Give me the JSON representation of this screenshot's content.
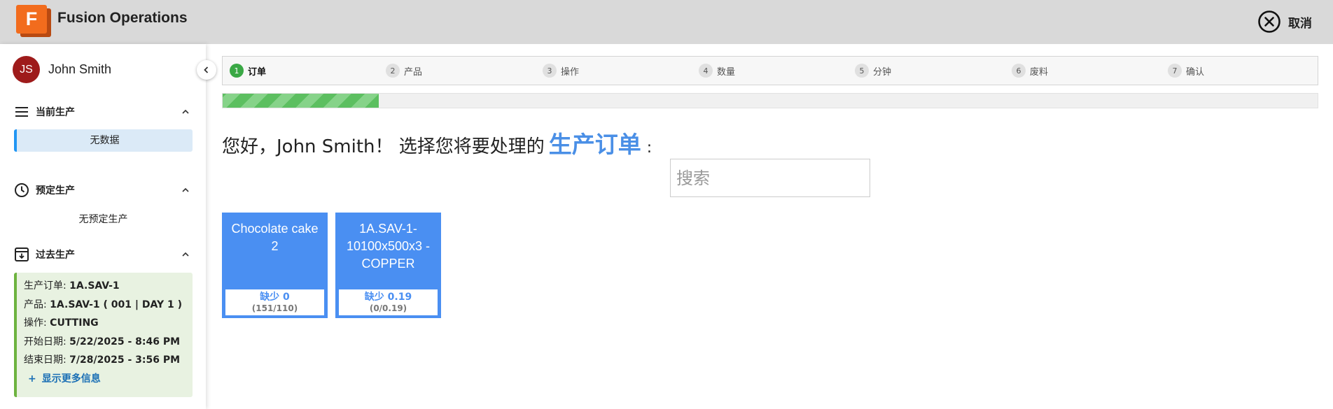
{
  "header": {
    "logo_letter": "F",
    "app_title": "Fusion Operations",
    "cancel_label": "取消",
    "cancel_icon": "close-circle-icon"
  },
  "sidebar": {
    "user": {
      "initials": "JS",
      "name": "John Smith"
    },
    "current": {
      "title": "当前生产",
      "icon": "menu-lines-icon",
      "empty_text": "无数据"
    },
    "scheduled": {
      "title": "预定生产",
      "icon": "clock-icon",
      "empty_text": "无预定生产"
    },
    "past": {
      "title": "过去生产",
      "icon": "download-box-icon",
      "rows": [
        {
          "label": "生产订单: ",
          "value": "1A.SAV-1"
        },
        {
          "label": "产品: ",
          "value": "1A.SAV-1 ( 001 | DAY 1 )"
        },
        {
          "label": "操作: ",
          "value": "CUTTING"
        },
        {
          "label": "开始日期: ",
          "value": "5/22/2025 - 8:46 PM"
        },
        {
          "label": "结束日期: ",
          "value": "7/28/2025 - 3:56 PM"
        }
      ],
      "more_label": "显示更多信息"
    }
  },
  "steps": [
    {
      "num": "1",
      "label": "订单",
      "active": true
    },
    {
      "num": "2",
      "label": "产品"
    },
    {
      "num": "3",
      "label": "操作"
    },
    {
      "num": "4",
      "label": "数量"
    },
    {
      "num": "5",
      "label": "分钟"
    },
    {
      "num": "6",
      "label": "废料"
    },
    {
      "num": "7",
      "label": "确认"
    }
  ],
  "progress_fraction": 0.1428,
  "main": {
    "greeting_prefix": "您好，John Smith！ 选择您将要处理的",
    "greeting_highlight": "生产订单",
    "greeting_suffix": ":",
    "search_placeholder": "搜索"
  },
  "orders": [
    {
      "title": "Chocolate cake 2",
      "shortage": "缺少 0",
      "ratio": "(151/110)"
    },
    {
      "title": "1A.SAV-1-10100x500x3 - COPPER",
      "shortage": "缺少 0.19",
      "ratio": "(0/0.19)"
    }
  ],
  "colors": {
    "accent": "#4a8ff2",
    "step_active": "#3aa845",
    "brand": "#f26c1d"
  }
}
